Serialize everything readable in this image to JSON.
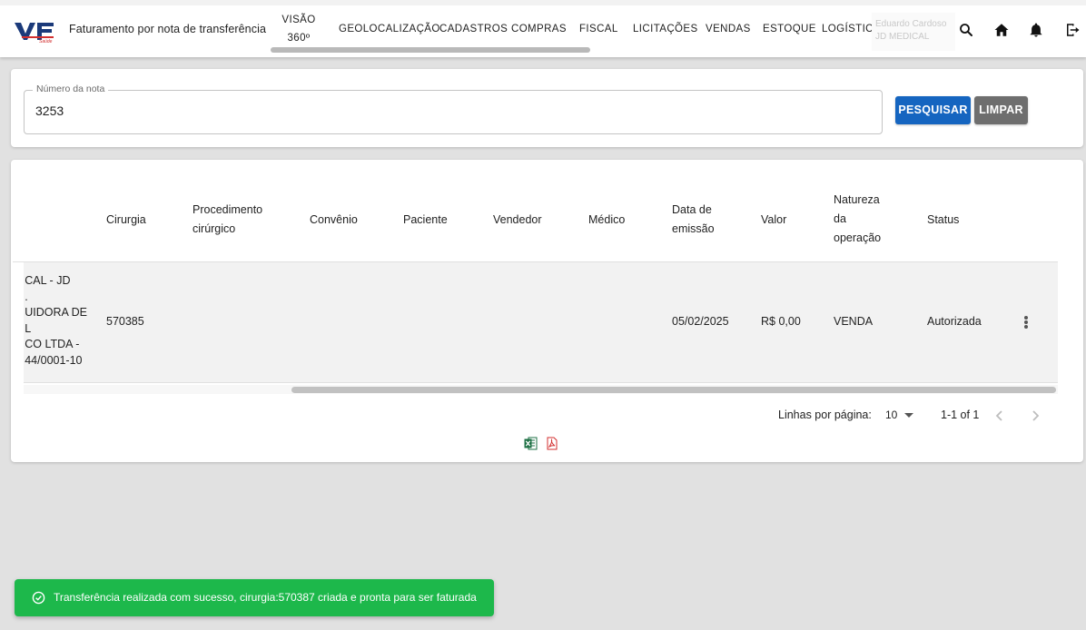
{
  "header": {
    "logo_text": "VF Saúde",
    "title": "Faturamento por nota de transferência",
    "nav": [
      {
        "line1": "VISÃO",
        "line2": "360º"
      },
      {
        "label": "GEOLOCALIZAÇÃO"
      },
      {
        "label": "CADASTROS"
      },
      {
        "label": "COMPRAS"
      },
      {
        "label": "FISCAL"
      },
      {
        "label": "LICITAÇÕES"
      },
      {
        "label": "VENDAS"
      },
      {
        "label": "ESTOQUE"
      },
      {
        "label": "LOGÍSTICA"
      }
    ],
    "user_name": "Eduardo Cardoso",
    "user_company": "JD MEDICAL"
  },
  "search": {
    "label": "Número da nota",
    "value": "3253",
    "search_button": "PESQUISAR",
    "clear_button": "LIMPAR"
  },
  "table": {
    "columns": {
      "surgery": "Cirurgia",
      "procedure_1": "Procedimento",
      "procedure_2": "cirúrgico",
      "covenant": "Convênio",
      "patient": "Paciente",
      "seller": "Vendedor",
      "doctor": "Médico",
      "date_1": "Data de",
      "date_2": "emissão",
      "value": "Valor",
      "nature_1": "Natureza",
      "nature_2": "da",
      "nature_3": "operação",
      "status": "Status"
    },
    "row": {
      "clipped_line1": "CAL - JD",
      "clipped_line2": ".",
      "clipped_line3": "UIDORA DE",
      "clipped_line4": "L",
      "clipped_line5": "CO LTDA -",
      "clipped_line6": "44/0001-10",
      "surgery": "570385",
      "procedure": "",
      "covenant": "",
      "patient": "",
      "seller": "",
      "doctor": "",
      "date": "05/02/2025",
      "value": "R$ 0,00",
      "nature": "VENDA",
      "status": "Autorizada"
    }
  },
  "pagination": {
    "rows_label": "Linhas por página:",
    "rows_value": "10",
    "range": "1-1 of 1"
  },
  "snackbar": {
    "message": "Transferência realizada com sucesso, cirurgia:570387 criada e pronta para ser faturada"
  },
  "colors": {
    "primary": "#1565c0",
    "success": "#1db84b",
    "excel": "#1d7044",
    "pdf": "#d32f2f"
  }
}
